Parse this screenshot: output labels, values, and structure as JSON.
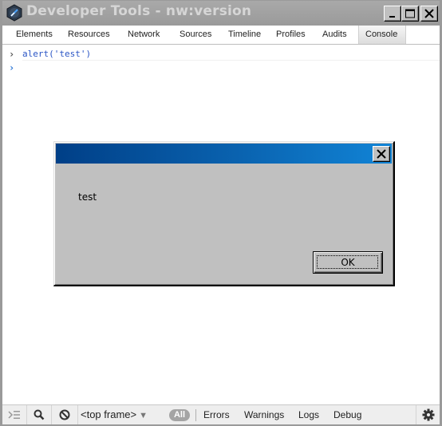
{
  "window": {
    "title": "Developer Tools - nw:version",
    "controls": {
      "minimize": "minimize-icon",
      "maximize": "maximize-icon",
      "close": "close-icon"
    }
  },
  "tabs": [
    {
      "label": "Elements",
      "active": false
    },
    {
      "label": "Resources",
      "active": false
    },
    {
      "label": "Network",
      "active": false
    },
    {
      "label": "Sources",
      "active": false
    },
    {
      "label": "Timeline",
      "active": false
    },
    {
      "label": "Profiles",
      "active": false
    },
    {
      "label": "Audits",
      "active": false
    },
    {
      "label": "Console",
      "active": true
    }
  ],
  "console": {
    "entries": [
      {
        "prompt": "›",
        "text": "alert('test')"
      }
    ],
    "input_prompt": "›",
    "input_value": ""
  },
  "alert_dialog": {
    "title": "",
    "message": "test",
    "ok_label": "OK"
  },
  "statusbar": {
    "icons": [
      "show-console-icon",
      "search-icon",
      "clear-console-icon",
      "settings-gear-icon"
    ],
    "frame_select": "<top frame>",
    "filters": {
      "all": "All",
      "errors": "Errors",
      "warnings": "Warnings",
      "logs": "Logs",
      "debug": "Debug"
    }
  },
  "colors": {
    "titlebar": "#9a9a9a",
    "title_text": "#d6d6d6",
    "console_text": "#2a55c5",
    "dialog_bg": "#c0c0c0",
    "dialog_title_start": "#003f87",
    "dialog_title_end": "#1184d6"
  }
}
